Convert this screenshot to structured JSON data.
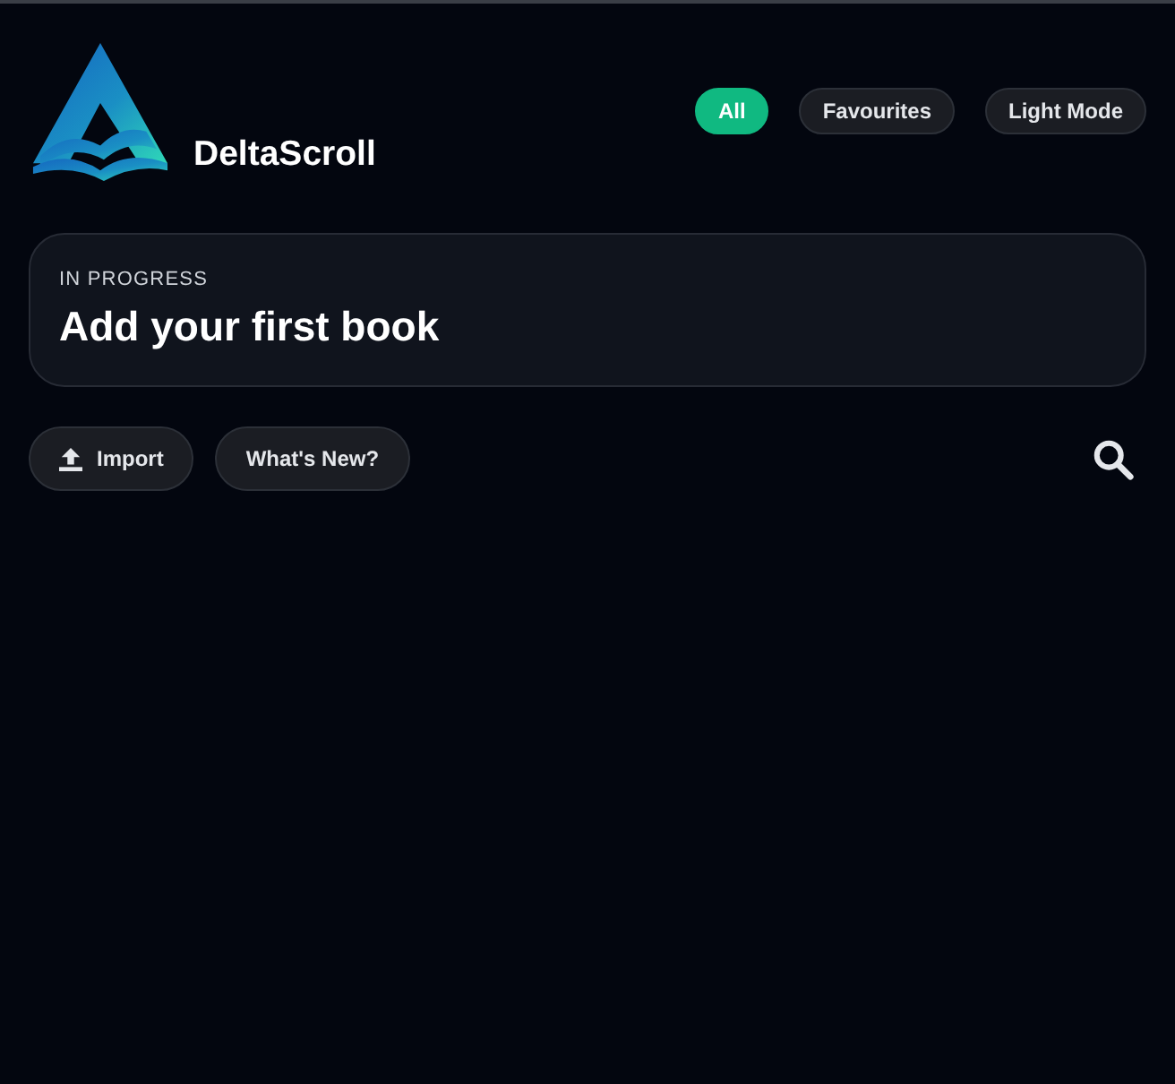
{
  "brand": {
    "name": "DeltaScroll"
  },
  "nav_pills": [
    {
      "label": "All",
      "selected": true
    },
    {
      "label": "Favourites",
      "selected": false
    },
    {
      "label": "Light Mode",
      "selected": false
    }
  ],
  "current_book": {
    "status": "IN PROGRESS",
    "title": "Add your first book"
  },
  "actions": [
    {
      "kind": "import",
      "label": "Import"
    },
    {
      "kind": "plain",
      "label": "What's New?"
    }
  ]
}
